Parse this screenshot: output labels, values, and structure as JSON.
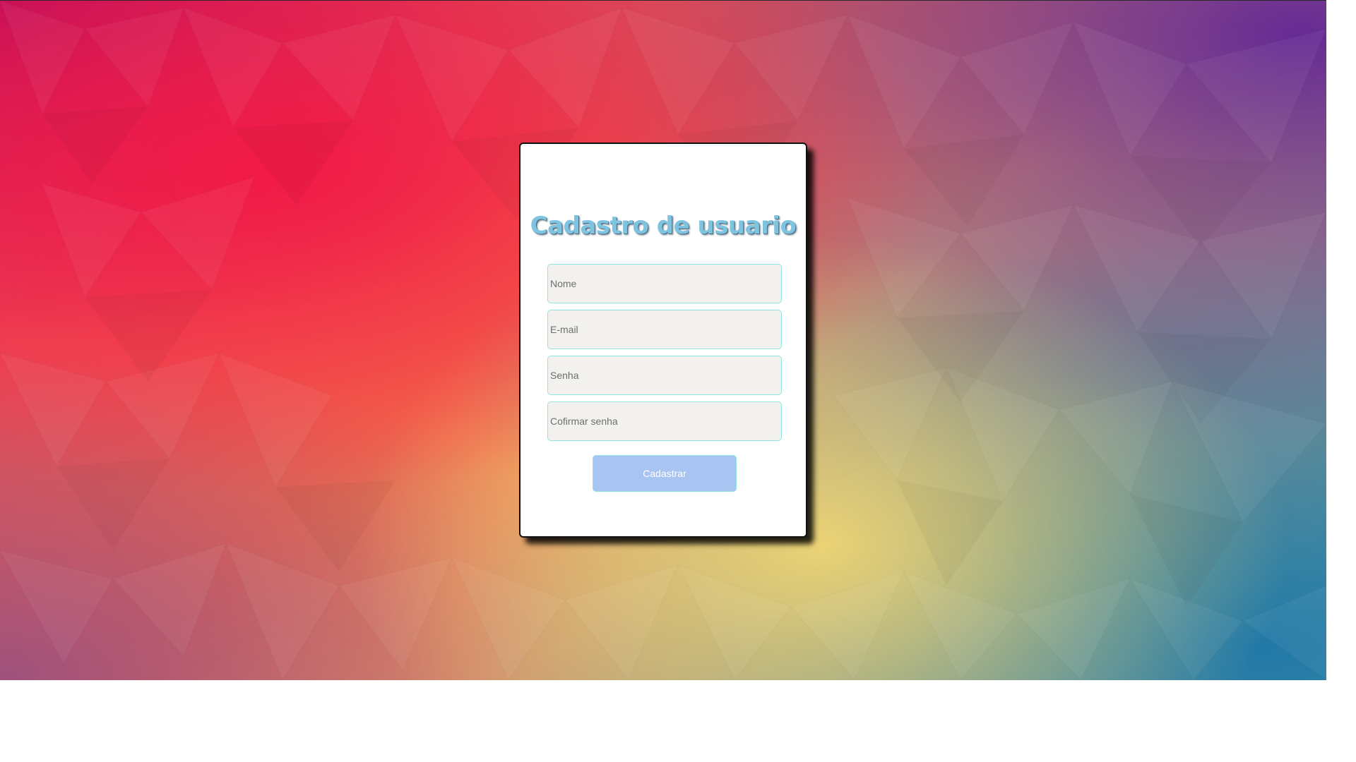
{
  "form": {
    "title": "Cadastro de usuario",
    "fields": [
      {
        "name": "nome",
        "placeholder": "Nome",
        "value": ""
      },
      {
        "name": "email",
        "placeholder": "E-mail",
        "value": ""
      },
      {
        "name": "senha",
        "placeholder": "Senha",
        "value": ""
      },
      {
        "name": "confirmar-senha",
        "placeholder": "Cofirmar senha",
        "value": ""
      }
    ],
    "submit_label": "Cadastrar"
  },
  "colors": {
    "title": "#7ec3e0",
    "field_bg": "#f2f1ee",
    "field_border": "#8fe6df",
    "button_bg": "#a8c4f1",
    "button_text": "#ffffff"
  }
}
